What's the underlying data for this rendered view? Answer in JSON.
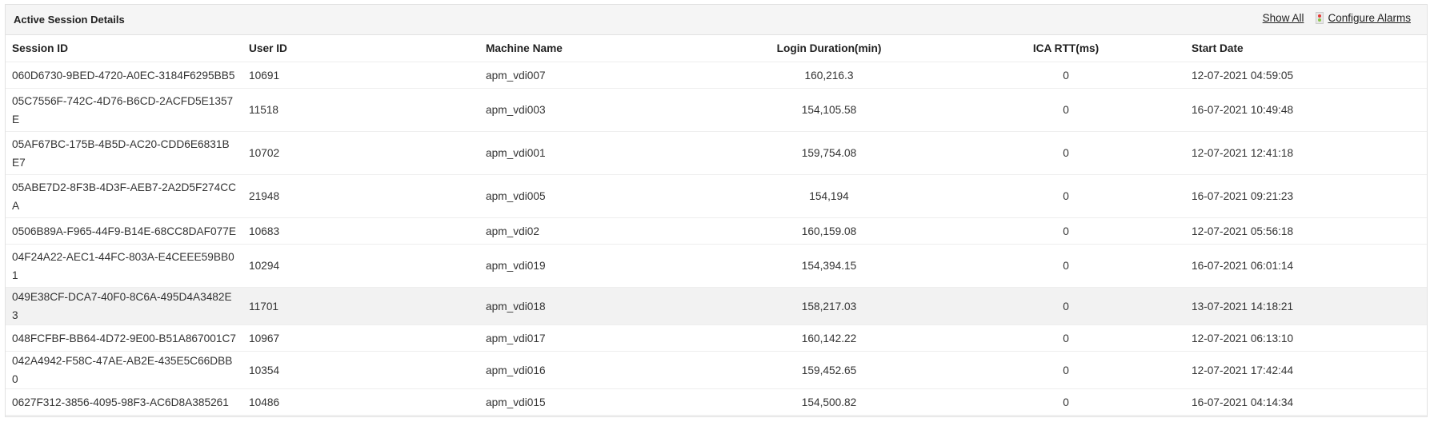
{
  "panel": {
    "title": "Active Session Details",
    "show_all": "Show All",
    "configure_alarms": "Configure Alarms"
  },
  "columns": [
    "Session ID",
    "User ID",
    "Machine Name",
    "Login Duration(min)",
    "ICA RTT(ms)",
    "Start Date"
  ],
  "rows": [
    [
      "060D6730-9BED-4720-A0EC-3184F6295BB5",
      "10691",
      "apm_vdi007",
      "160,216.3",
      "0",
      "12-07-2021 04:59:05"
    ],
    [
      "05C7556F-742C-4D76-B6CD-2ACFD5E1357E",
      "11518",
      "apm_vdi003",
      "154,105.58",
      "0",
      "16-07-2021 10:49:48"
    ],
    [
      "05AF67BC-175B-4B5D-AC20-CDD6E6831BE7",
      "10702",
      "apm_vdi001",
      "159,754.08",
      "0",
      "12-07-2021 12:41:18"
    ],
    [
      "05ABE7D2-8F3B-4D3F-AEB7-2A2D5F274CCA",
      "21948",
      "apm_vdi005",
      "154,194",
      "0",
      "16-07-2021 09:21:23"
    ],
    [
      "0506B89A-F965-44F9-B14E-68CC8DAF077E",
      "10683",
      "apm_vdi02",
      "160,159.08",
      "0",
      "12-07-2021 05:56:18"
    ],
    [
      "04F24A22-AEC1-44FC-803A-E4CEEE59BB01",
      "10294",
      "apm_vdi019",
      "154,394.15",
      "0",
      "16-07-2021 06:01:14"
    ],
    [
      "049E38CF-DCA7-40F0-8C6A-495D4A3482E3",
      "11701",
      "apm_vdi018",
      "158,217.03",
      "0",
      "13-07-2021 14:18:21"
    ],
    [
      "048FCFBF-BB64-4D72-9E00-B51A867001C7",
      "10967",
      "apm_vdi017",
      "160,142.22",
      "0",
      "12-07-2021 06:13:10"
    ],
    [
      "042A4942-F58C-47AE-AB2E-435E5C66DBB0",
      "10354",
      "apm_vdi016",
      "159,452.65",
      "0",
      "12-07-2021 17:42:44"
    ],
    [
      "0627F312-3856-4095-98F3-AC6D8A385261",
      "10486",
      "apm_vdi015",
      "154,500.82",
      "0",
      "16-07-2021 04:14:34"
    ]
  ]
}
